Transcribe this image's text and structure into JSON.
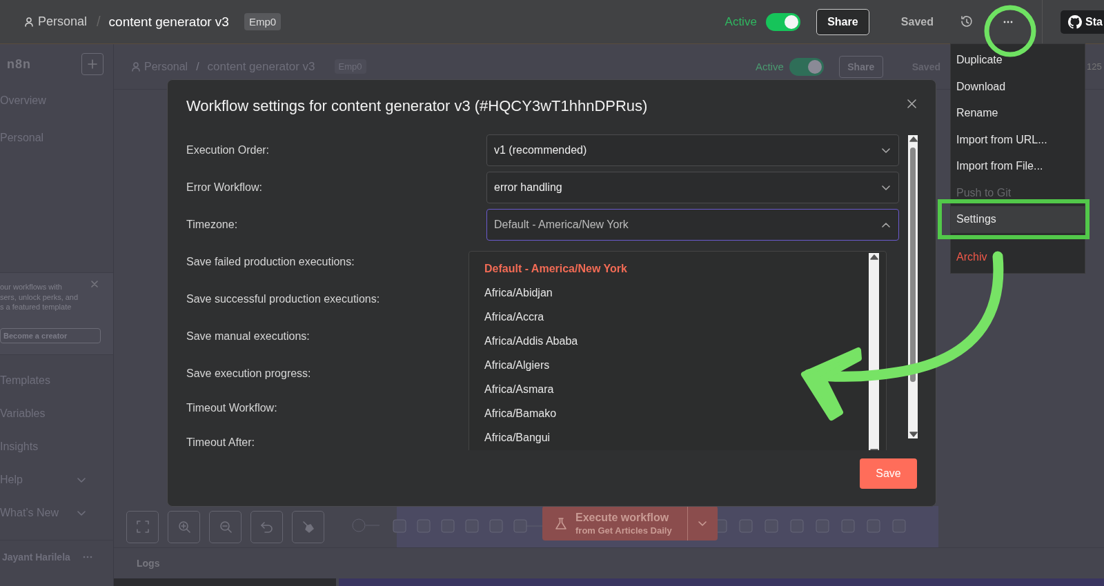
{
  "header": {
    "project": "Personal",
    "separator": "/",
    "workflow": "content generator v3",
    "tag": "Emp0",
    "active": {
      "label": "Active",
      "on": true
    },
    "share": "Share",
    "status": "Saved",
    "github": "Sta"
  },
  "sidebar": {
    "logo": "n8n",
    "items": [
      {
        "label": "Overview",
        "expandable": false
      },
      {
        "label": "Personal",
        "expandable": false
      }
    ],
    "promo": {
      "lines": [
        "our workflows with",
        "sers, unlock perks, and",
        "s a featured template"
      ],
      "button": "Become a creator"
    },
    "more_items": [
      {
        "label": "Templates",
        "expandable": false
      },
      {
        "label": "Variables",
        "expandable": false
      },
      {
        "label": "Insights",
        "expandable": false
      },
      {
        "label": "Help",
        "expandable": true
      },
      {
        "label": "What’s New",
        "expandable": true
      }
    ],
    "user": "Jayant Harilela"
  },
  "canvas_header": {
    "project": "Personal",
    "separator": "/",
    "workflow": "content generator v3",
    "tag": "Emp0",
    "active": {
      "label": "Active",
      "on": true
    },
    "share": "Share",
    "status": "Saved",
    "zoom": "125"
  },
  "canvas": {
    "execute": {
      "title": "Execute workflow",
      "subtitle": "from Get Articles Daily"
    },
    "logs": "Logs"
  },
  "modal": {
    "title": "Workflow settings for content generator v3 (#HQCY3wT1hhnDPRus)",
    "settings": [
      {
        "label": "Execution Order:",
        "kind": "select",
        "value": "v1 (recommended)",
        "expanded": false
      },
      {
        "label": "Error Workflow:",
        "kind": "select",
        "value": "error handling",
        "expanded": false
      },
      {
        "label": "Timezone:",
        "kind": "select",
        "placeholder": "Default - America/New York",
        "expanded": true,
        "options": [
          {
            "label": "Default - America/New York",
            "selected": true
          },
          {
            "label": "Africa/Abidjan",
            "selected": false
          },
          {
            "label": "Africa/Accra",
            "selected": false
          },
          {
            "label": "Africa/Addis Ababa",
            "selected": false
          },
          {
            "label": "Africa/Algiers",
            "selected": false
          },
          {
            "label": "Africa/Asmara",
            "selected": false
          },
          {
            "label": "Africa/Bamako",
            "selected": false
          },
          {
            "label": "Africa/Bangui",
            "selected": false
          }
        ]
      },
      {
        "label": "Save failed production executions:",
        "kind": "label"
      },
      {
        "label": "Save successful production executions:",
        "kind": "label"
      },
      {
        "label": "Save manual executions:",
        "kind": "label"
      },
      {
        "label": "Save execution progress:",
        "kind": "label"
      },
      {
        "label": "Timeout Workflow:",
        "kind": "label"
      },
      {
        "label": "Timeout After:",
        "kind": "label"
      }
    ],
    "save": "Save"
  },
  "menu": {
    "items": [
      {
        "label": "Duplicate",
        "kind": "action",
        "disabled": false,
        "selected": false
      },
      {
        "label": "Download",
        "kind": "action",
        "disabled": false,
        "selected": false
      },
      {
        "label": "Rename",
        "kind": "action",
        "disabled": false,
        "selected": false
      },
      {
        "label": "Import from URL...",
        "kind": "action",
        "disabled": false,
        "selected": false
      },
      {
        "label": "Import from File...",
        "kind": "action",
        "disabled": false,
        "selected": false
      },
      {
        "label": "Push to Git",
        "kind": "action",
        "disabled": true,
        "selected": false
      },
      {
        "label": "Settings",
        "kind": "action",
        "disabled": false,
        "selected": true
      },
      {
        "label": "Archiv",
        "kind": "danger",
        "disabled": false,
        "selected": false
      }
    ]
  }
}
